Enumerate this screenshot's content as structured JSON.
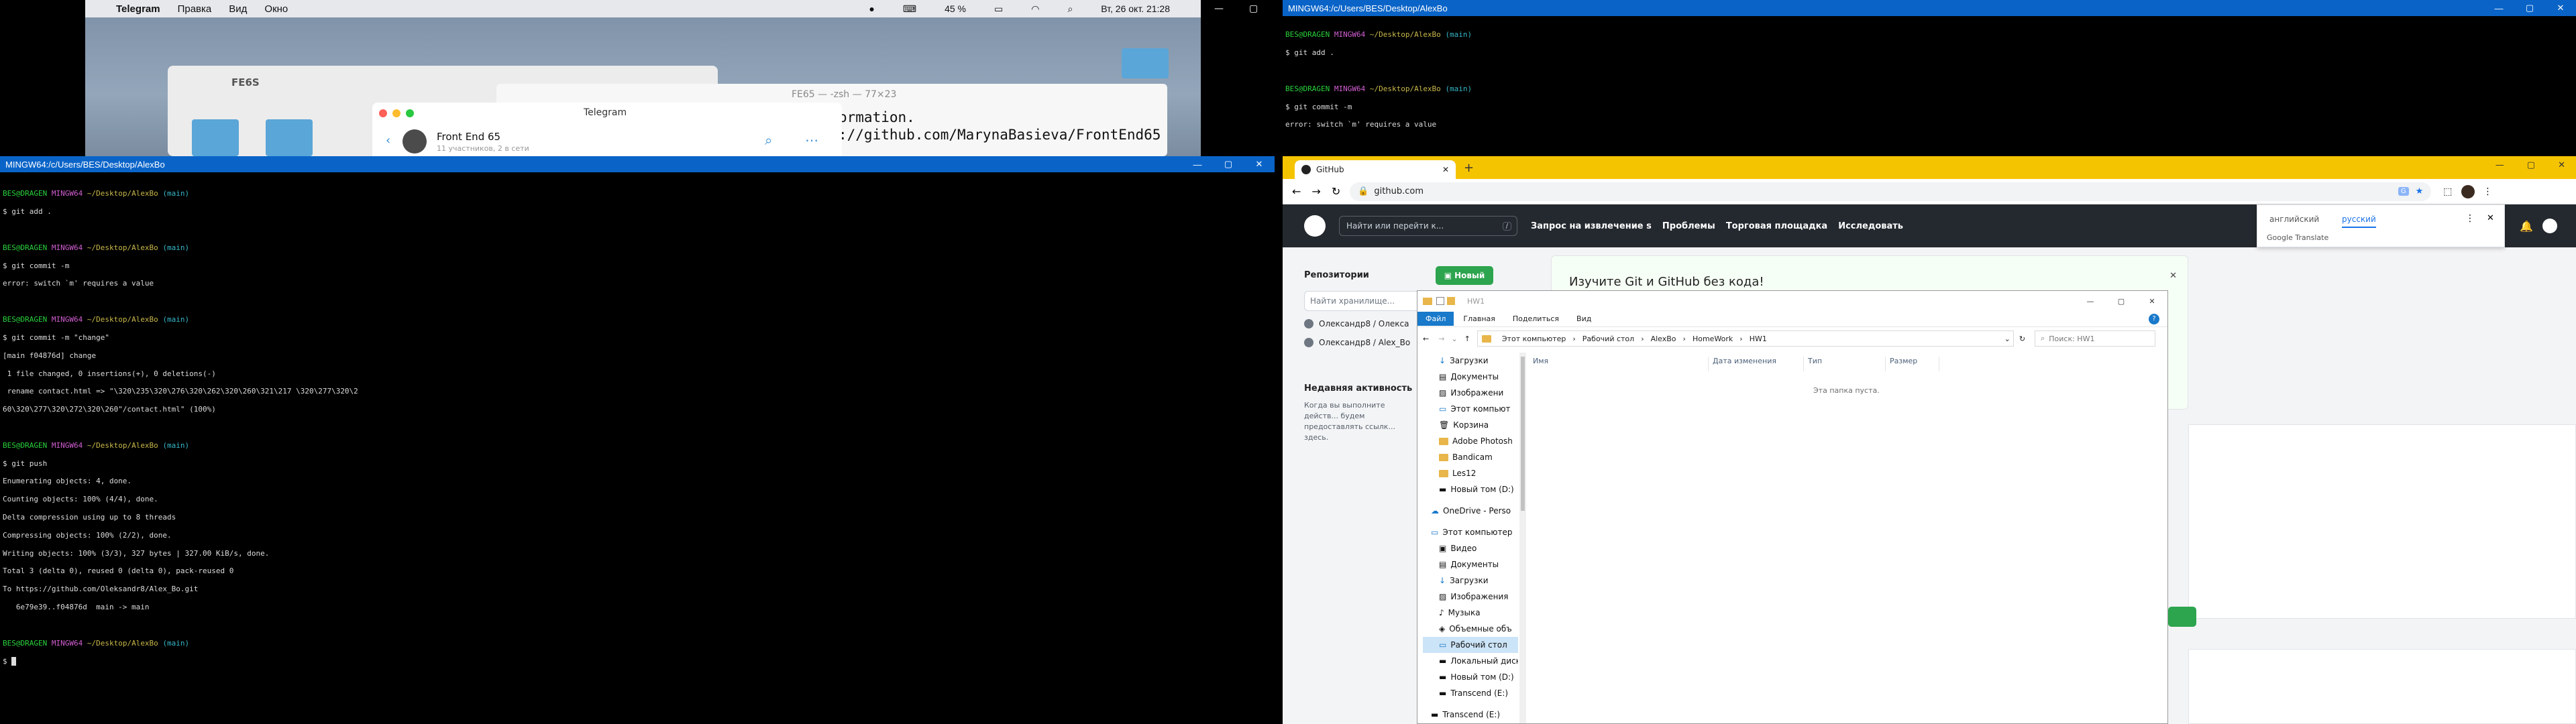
{
  "mac": {
    "menu": [
      "Telegram",
      "Правка",
      "Вид",
      "Окно"
    ],
    "status": {
      "battery": "45 %",
      "datetime": "Вт, 26 окт.  21:28"
    },
    "finder_title": "FE6S",
    "zsh_title": "FE65 — -zsh — 77×23",
    "zsh_lines": [
      "ormation.",
      "://github.com/MarynaBasieva/FrontEnd65"
    ],
    "telegram": {
      "title": "Telegram",
      "chat": "Front End 65",
      "sub": "11 участников, 2 в сети"
    }
  },
  "term_left": {
    "title": "MINGW64:/c/Users/BES/Desktop/AlexBo",
    "prompt_user": "BES@DRAGEN",
    "prompt_env": "MINGW64",
    "prompt_path": "~/Desktop/AlexBo",
    "prompt_branch": "(main)",
    "l1": "$ git add .",
    "l2": "$ git commit -m",
    "l3": "error: switch `m' requires a value",
    "l4": "$ git commit -m \"change\"",
    "l5": "[main f04876d] change",
    "l6": " 1 file changed, 0 insertions(+), 0 deletions(-)",
    "l7": " rename contact.html => \"\\320\\235\\320\\276\\320\\262\\320\\260\\321\\217 \\320\\277\\320\\2",
    "l8": "60\\320\\277\\320\\272\\320\\260\"/contact.html\" (100%)",
    "l9": "$ git push",
    "push": [
      "Enumerating objects: 4, done.",
      "Counting objects: 100% (4/4), done.",
      "Delta compression using up to 8 threads",
      "Compressing objects: 100% (2/2), done.",
      "Writing objects: 100% (3/3), 327 bytes | 327.00 KiB/s, done.",
      "Total 3 (delta 0), reused 0 (delta 0), pack-reused 0",
      "To https://github.com/Oleksandr8/Alex_Bo.git",
      "   6e79e39..f04876d  main -> main"
    ],
    "l10": "$ "
  },
  "term_right": {
    "title": "MINGW64:/c/Users/BES/Desktop/AlexBo"
  },
  "chrome": {
    "tab": "GitHub",
    "url": "github.com",
    "search_placeholder": "Найти или перейти к...",
    "search_key": "/",
    "nav": [
      "Запрос на извлечение s",
      "Проблемы",
      "Торговая площадка",
      "Исследовать"
    ],
    "repos_label": "Репозитории",
    "new_btn": "Новый",
    "find_repo": "Найти хранилище...",
    "repo1": "Олександр8 / Олекса",
    "repo2": "Олександр8 / Alex_Bo",
    "recent": "Недавняя активность",
    "recent_text": "Когда вы выполните действ... будем предоставлять ссылк... здесь.",
    "learn_title": "Изучите Git и GitHub без кода!",
    "translate": {
      "lang1": "английский",
      "lang2": "русский",
      "brand": "Google Translate"
    }
  },
  "explorer": {
    "title": "HW1",
    "ribbon": [
      "Файл",
      "Главная",
      "Поделиться",
      "Вид"
    ],
    "path": [
      "Этот компьютер",
      "Рабочий стол",
      "AlexBo",
      "HomeWork",
      "HW1"
    ],
    "search": "Поиск: HW1",
    "cols": [
      "Имя",
      "Дата изменения",
      "Тип",
      "Размер"
    ],
    "empty": "Эта папка пуста.",
    "side": [
      "Загрузки",
      "Документы",
      "Изображени",
      "Этот компьют",
      "Корзина",
      "Adobe Photosh",
      "Bandicam",
      "Les12",
      "Новый том (D:)",
      "OneDrive - Perso",
      "Этот компьютер",
      "Видео",
      "Документы",
      "Загрузки",
      "Изображения",
      "Музыка",
      "Объемные объ",
      "Рабочий стол",
      "Локальный диск",
      "Новый том (D:)",
      "Transcend (E:)",
      "Transcend (E:)"
    ]
  }
}
